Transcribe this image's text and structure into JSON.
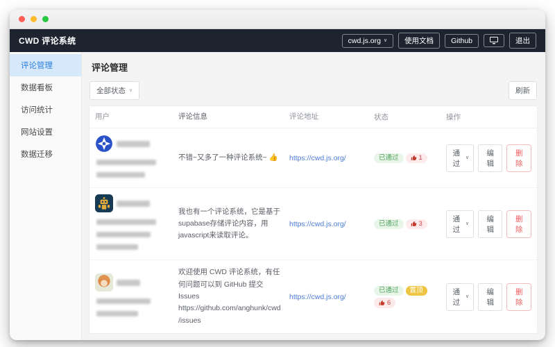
{
  "navbar": {
    "brand": "CWD 评论系统",
    "site_select_value": "cwd.js.org",
    "docs_label": "使用文档",
    "github_label": "Github",
    "logout_label": "退出",
    "chevron_icon": "∨"
  },
  "sidebar": {
    "items": [
      {
        "label": "评论管理"
      },
      {
        "label": "数据看板"
      },
      {
        "label": "访问统计"
      },
      {
        "label": "网站设置"
      },
      {
        "label": "数据迁移"
      }
    ]
  },
  "main": {
    "page_title": "评论管理",
    "filter_select_value": "全部状态",
    "refresh_label": "刷新",
    "table": {
      "headers": {
        "user": "用户",
        "comment": "评论信息",
        "url": "评论地址",
        "status": "状态",
        "actions": "操作"
      },
      "rows": [
        {
          "comment": "不错~又多了一种评论系统~ 👍",
          "url": "https://cwd.js.org/",
          "status": "已通过",
          "likes": "1",
          "action_select_value": "通过",
          "edit_label": "编辑",
          "delete_label": "删除"
        },
        {
          "comment": "我也有一个评论系统，它是基于supabase存储评论内容，用javascript来读取评论。",
          "url": "https://cwd.js.org/",
          "status": "已通过",
          "likes": "3",
          "action_select_value": "通过",
          "edit_label": "编辑",
          "delete_label": "删除"
        },
        {
          "comment": "欢迎使用 CWD 评论系统，有任何问题可以到 GitHub 提交 Issues https://github.com/anghunk/cwd/issues",
          "url": "https://cwd.js.org/",
          "status": "已通过",
          "pinned": "置顶",
          "likes": "6",
          "action_select_value": "通过",
          "edit_label": "编辑",
          "delete_label": "删除"
        }
      ]
    }
  },
  "colors": {
    "navbar_bg": "#1d2430",
    "sidebar_active_bg": "#d6e9fb",
    "sidebar_active_text": "#2f7fe0",
    "link": "#4b7cd6",
    "approved_bg": "#e7f6e9",
    "approved_text": "#55a15b",
    "pinned_bg": "#eec643",
    "like_bg": "#fdeaea",
    "like_text": "#cf4444",
    "delete_text": "#ec5b5b"
  }
}
